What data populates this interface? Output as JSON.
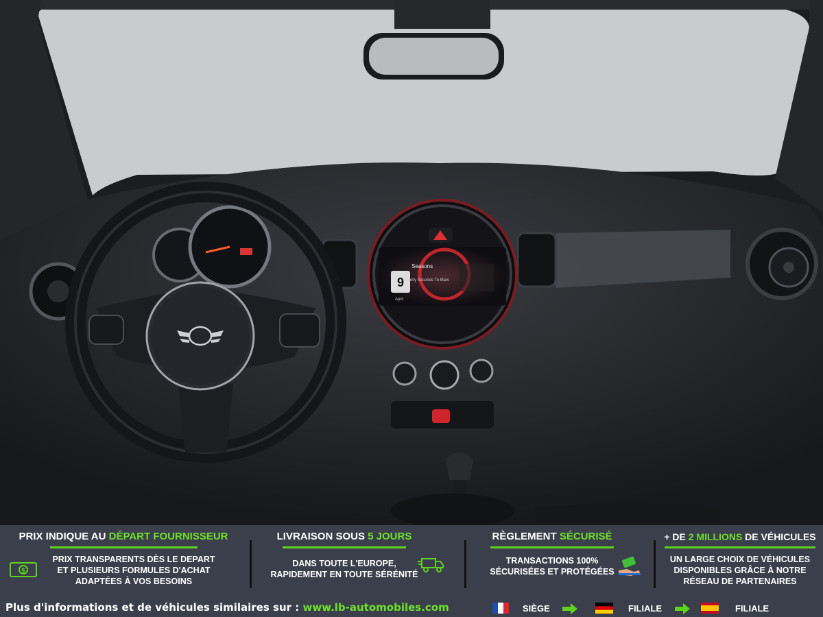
{
  "image": {
    "description_icons": [
      "steering-wheel",
      "mini-logo",
      "infotainment-screen",
      "gear-shifter"
    ],
    "screen": {
      "title": "Seasons",
      "subtitle": "Thirty Seconds To Mars",
      "big_number": "9",
      "month": "April"
    }
  },
  "banner": {
    "col1": {
      "title_prefix": "PRIX INDIQUE AU ",
      "title_highlight": "DÉPART FOURNISSEUR",
      "title_suffix": "",
      "lines": [
        "PRIX TRANSPARENTS DÈS LE DEPART",
        "ET PLUSIEURS FORMULES D'ACHAT",
        "ADAPTÉES À VOS BESOINS"
      ],
      "icon": "money-icon"
    },
    "col2": {
      "title_prefix": "LIVRAISON SOUS ",
      "title_highlight": "5 JOURS",
      "title_suffix": "",
      "lines": [
        "DANS TOUTE L'EUROPE,",
        "RAPIDEMENT EN TOUTE SÉRÉNITÉ"
      ],
      "icon": "delivery-truck-icon"
    },
    "col3": {
      "title_prefix": "RÈGLEMENT ",
      "title_highlight": "SÉCURISÉ",
      "title_suffix": "",
      "lines": [
        "TRANSACTIONS 100%",
        "SÉCURISÉES ET PROTÉGÉES"
      ],
      "icon": "payment-hand-icon"
    },
    "col4": {
      "title_prefix": "+ DE ",
      "title_highlight": "2 MILLIONS",
      "title_suffix": " DE VÉHICULES",
      "lines": [
        "UN LARGE CHOIX DE VÉHICULES",
        "DISPONIBLES GRÂCE À NOTRE",
        "RÉSEAU DE PARTENAIRES"
      ]
    },
    "footer": {
      "info_text": "Plus d'informations et de véhicules similaires sur : ",
      "url": "www.lb-automobiles.com",
      "locations": [
        {
          "flag": "france-flag",
          "label": "SIÈGE"
        },
        {
          "flag": "germany-flag",
          "label": "FILIALE"
        },
        {
          "flag": "spain-flag",
          "label": "FILIALE"
        }
      ]
    },
    "colors": {
      "accent": "#6ee02a",
      "banner_bg": "#3b3f4c"
    }
  }
}
